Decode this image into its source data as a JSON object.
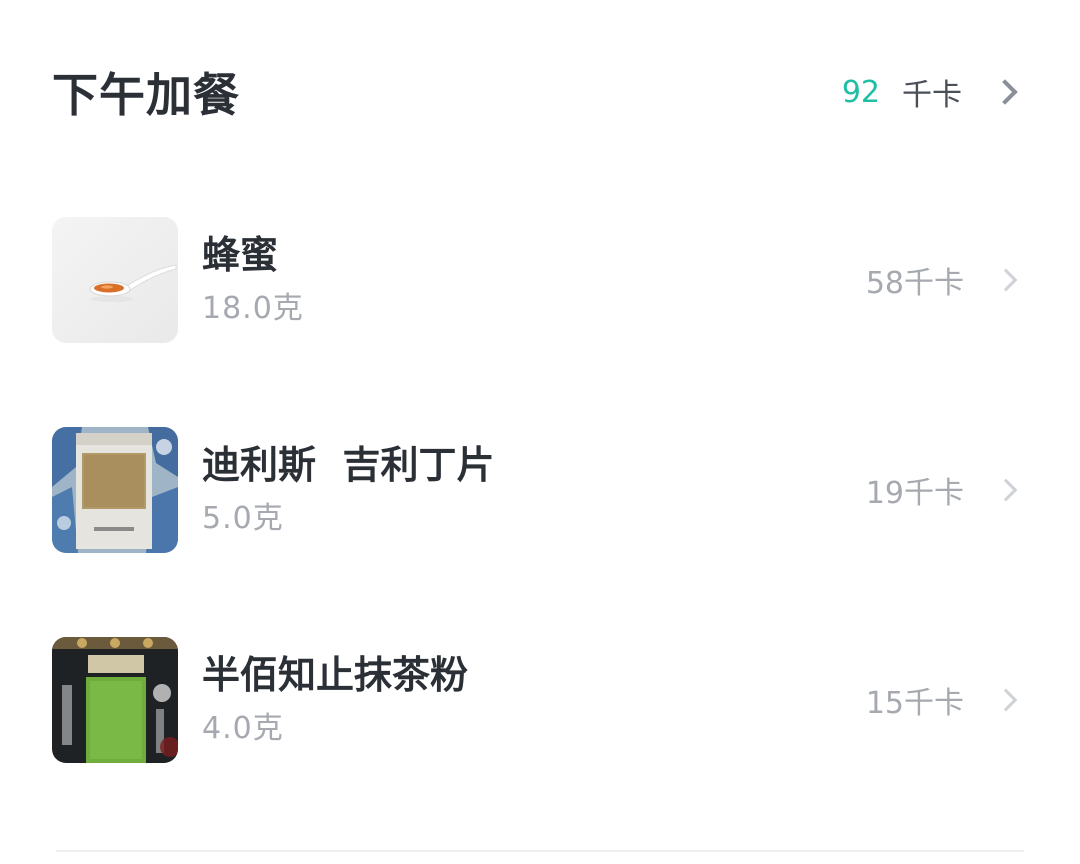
{
  "meal": {
    "title": "下午加餐",
    "total_kcal": "92",
    "kcal_unit": "千卡",
    "chevron_icon": "chevron-right-icon"
  },
  "items": [
    {
      "name": "蜂蜜",
      "amount": "18.0克",
      "kcal": "58千卡",
      "thumb": "honey-spoon-photo"
    },
    {
      "name": "迪利斯  吉利丁片",
      "amount": "5.0克",
      "kcal": "19千卡",
      "thumb": "gelatin-package-photo"
    },
    {
      "name": "半佰知止抹茶粉",
      "amount": "4.0克",
      "kcal": "15千卡",
      "thumb": "matcha-package-photo"
    }
  ],
  "colors": {
    "accent": "#20bfa5",
    "title": "#2b2f36",
    "muted": "#a6aab0"
  }
}
